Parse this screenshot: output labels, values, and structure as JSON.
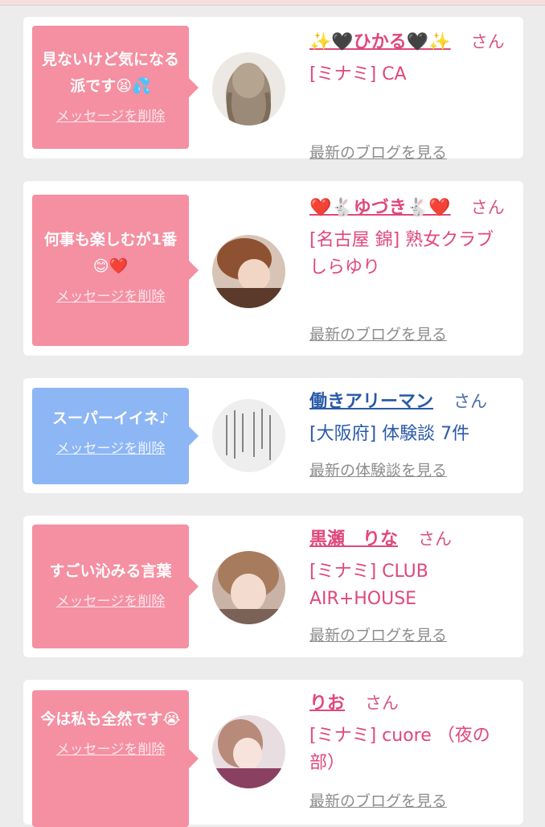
{
  "cards": [
    {
      "message": "見ないけど気になる派です😫💦",
      "delete_label": "メッセージを削除",
      "name": "✨🖤ひかる🖤✨",
      "honorific": "さん",
      "area": "[ミナミ] CA",
      "blog_link": "最新のブログを見る",
      "bubble_color": "#f58fa2"
    },
    {
      "message": "何事も楽しむが1番😊❤️",
      "delete_label": "メッセージを削除",
      "name": "❤️🐇ゆづき🐇❤️",
      "honorific": "さん",
      "area": "[名古屋 錦] 熟女クラブしらゆり",
      "blog_link": "最新のブログを見る",
      "bubble_color": "#f58fa2"
    },
    {
      "message": "スーパーイイネ♪",
      "delete_label": "メッセージを削除",
      "name": "働きアリーマン",
      "honorific": "さん",
      "area": "[大阪府] 体験談 7件",
      "blog_link": "最新の体験談を見る",
      "bubble_color": "#8db6f5"
    },
    {
      "message": "すごい沁みる言葉",
      "delete_label": "メッセージを削除",
      "name": "黒瀬　りな",
      "honorific": "さん",
      "area": "[ミナミ] CLUB AIR+HOUSE",
      "blog_link": "最新のブログを見る",
      "bubble_color": "#f58fa2"
    },
    {
      "message": "今は私も全然です😭",
      "delete_label": "メッセージを削除",
      "name": "りお",
      "honorific": "さん",
      "area": "[ミナミ] cuore （夜の部）",
      "blog_link": "最新のブログを見る",
      "bubble_color": "#f58fa2"
    }
  ]
}
